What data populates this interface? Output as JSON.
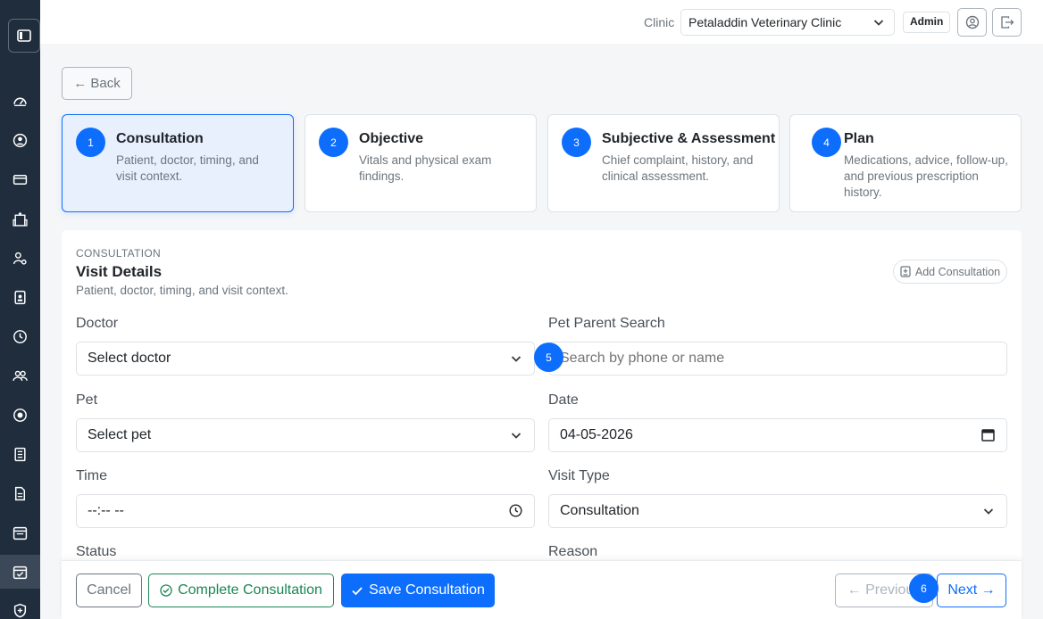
{
  "topbar": {
    "clinic_label": "Clinic",
    "clinic_selected": "Petaladdin Veterinary Clinic",
    "admin_badge": "Admin"
  },
  "back_label": "← Back",
  "steps": [
    {
      "number": "1",
      "title": "Consultation",
      "description": "Patient, doctor, timing, and visit context."
    },
    {
      "number": "2",
      "title": "Objective",
      "description": "Vitals and physical exam findings."
    },
    {
      "number": "3",
      "title": "Subjective & Assessment",
      "description": "Chief complaint, history, and clinical assessment."
    },
    {
      "number": "4",
      "title": "Plan",
      "description": "Medications, advice, follow-up, and previous prescription history."
    }
  ],
  "card": {
    "eyebrow": "CONSULTATION",
    "title": "Visit Details",
    "subtitle": "Patient, doctor, timing, and visit context.",
    "add_button": "Add Consultation"
  },
  "form": {
    "doctor_label": "Doctor",
    "doctor_value": "Select doctor",
    "pet_parent_label": "Pet Parent Search",
    "pet_parent_placeholder": "Search by phone or name",
    "pet_label": "Pet",
    "pet_value": "Select pet",
    "date_label": "Date",
    "date_value": "04-05-2026",
    "time_label": "Time",
    "time_value": "--:-- --",
    "visit_type_label": "Visit Type",
    "visit_type_value": "Consultation",
    "status_label": "Status",
    "reason_label": "Reason"
  },
  "footer": {
    "cancel": "Cancel",
    "complete": "Complete Consultation",
    "save": "Save Consultation",
    "previous": "← Previous",
    "next": "Next →"
  },
  "markers": [
    "5",
    "6"
  ],
  "colors": {
    "primary": "#0d6efd",
    "success": "#198754",
    "sidebar": "#1f2d3d"
  }
}
